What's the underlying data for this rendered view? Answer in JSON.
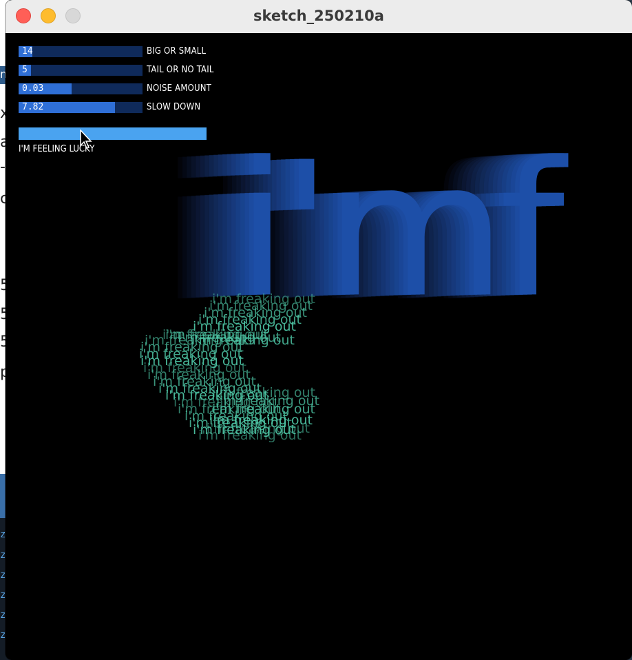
{
  "window": {
    "title": "sketch_250210a"
  },
  "sliders": [
    {
      "value": "14",
      "label": "BIG OR SMALL",
      "fill_fraction": 0.11
    },
    {
      "value": "5",
      "label": "TAIL OR NO TAIL",
      "fill_fraction": 0.1
    },
    {
      "value": "0.03",
      "label": "NOISE AMOUNT",
      "fill_fraction": 0.43
    },
    {
      "value": "7.82",
      "label": "SLOW DOWN",
      "fill_fraction": 0.78
    }
  ],
  "button": {
    "label": "I'M FEELING LUCKY"
  },
  "artwork": {
    "big_text": "i'mf",
    "small_text": "i'm freaking out"
  },
  "desktop_bg": {
    "chars": [
      "n",
      "x",
      "a",
      "-",
      "c",
      "5",
      "5",
      "5",
      "p"
    ],
    "z_chars": [
      "z",
      "z",
      "z",
      "z",
      "z",
      "z"
    ]
  },
  "colors": {
    "accent": "#4aa3f0",
    "slider_track": "#0f2a5a",
    "slider_fill": "#2f6fd6",
    "big_text": "#1d4fa8",
    "small_text": "#4fc9a8",
    "close": "#ff5f57",
    "minimize": "#febc2e",
    "maximize": "#d8d8d8"
  },
  "icons": [
    "close-button",
    "minimize-button",
    "maximize-button",
    "arrow-cursor-icon"
  ]
}
